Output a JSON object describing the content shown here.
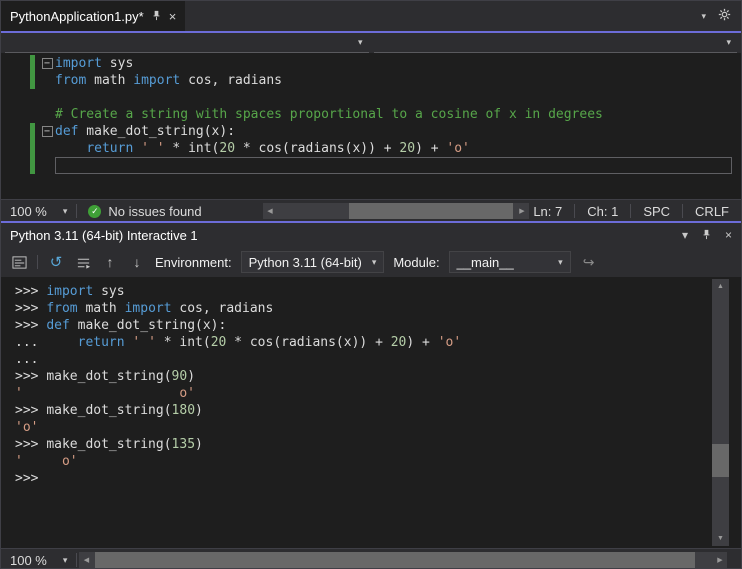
{
  "colors": {
    "accent_purple": "#6c6cd8",
    "keyword_blue": "#569cd6",
    "comment_green": "#57a64a",
    "string_orange": "#d69d85",
    "number_green": "#b5cea8",
    "foreground": "#dcdcdc",
    "issues_ok_green": "#3fa037",
    "change_bar_green": "#419641"
  },
  "icons": {
    "close": "×",
    "chevron_down": "▾",
    "check": "✓",
    "reset": "↺",
    "arrow_up": "↑",
    "arrow_down": "↓",
    "send": "↪",
    "scroll_left": "◀",
    "scroll_right": "▶",
    "scroll_up": "▲",
    "scroll_down": "▼",
    "fold_collapse": "−"
  },
  "tab_bar": {
    "tab_title": "PythonApplication1.py*"
  },
  "editor": {
    "lines": [
      {
        "fold": true,
        "changed": true,
        "tokens": [
          {
            "t": "kw",
            "s": "import"
          },
          {
            "t": "pl",
            "s": " sys"
          }
        ]
      },
      {
        "changed": true,
        "tokens": [
          {
            "t": "kw",
            "s": "from"
          },
          {
            "t": "pl",
            "s": " math "
          },
          {
            "t": "kw",
            "s": "import"
          },
          {
            "t": "pl",
            "s": " cos, radians"
          }
        ]
      },
      {
        "tokens": []
      },
      {
        "tokens": [
          {
            "t": "cm",
            "s": "# Create a string with spaces proportional to a cosine of x in degrees"
          }
        ]
      },
      {
        "fold": true,
        "changed": true,
        "tokens": [
          {
            "t": "kw",
            "s": "def"
          },
          {
            "t": "pl",
            "s": " make_dot_string(x):"
          }
        ]
      },
      {
        "changed": true,
        "tokens": [
          {
            "t": "pl",
            "s": "    "
          },
          {
            "t": "kw",
            "s": "return"
          },
          {
            "t": "pl",
            "s": " "
          },
          {
            "t": "str",
            "s": "' '"
          },
          {
            "t": "pl",
            "s": " * int("
          },
          {
            "t": "num",
            "s": "20"
          },
          {
            "t": "pl",
            "s": " * cos(radians(x)) + "
          },
          {
            "t": "num",
            "s": "20"
          },
          {
            "t": "pl",
            "s": ") + "
          },
          {
            "t": "str",
            "s": "'o'"
          }
        ]
      },
      {
        "changed": true,
        "boxed": true,
        "tokens": []
      }
    ]
  },
  "editor_status": {
    "zoom": "100 %",
    "issues": "No issues found",
    "line": "Ln: 7",
    "column": "Ch: 1",
    "insert_mode": "SPC",
    "line_ending": "CRLF"
  },
  "interactive": {
    "title": "Python 3.11 (64-bit) Interactive 1",
    "toolbar": {
      "environment_label": "Environment:",
      "environment_value": "Python 3.11 (64-bit)",
      "module_label": "Module:",
      "module_value": "__main__"
    },
    "lines": [
      {
        "tokens": [
          {
            "t": "prm",
            "s": ">>> "
          },
          {
            "t": "kw",
            "s": "import"
          },
          {
            "t": "pl",
            "s": " sys"
          }
        ]
      },
      {
        "tokens": [
          {
            "t": "prm",
            "s": ">>> "
          },
          {
            "t": "kw",
            "s": "from"
          },
          {
            "t": "pl",
            "s": " math "
          },
          {
            "t": "kw",
            "s": "import"
          },
          {
            "t": "pl",
            "s": " cos, radians"
          }
        ]
      },
      {
        "tokens": [
          {
            "t": "prm",
            "s": ">>> "
          },
          {
            "t": "kw",
            "s": "def"
          },
          {
            "t": "pl",
            "s": " make_dot_string(x):"
          }
        ]
      },
      {
        "tokens": [
          {
            "t": "prm",
            "s": "... "
          },
          {
            "t": "pl",
            "s": "    "
          },
          {
            "t": "kw",
            "s": "return"
          },
          {
            "t": "pl",
            "s": " "
          },
          {
            "t": "str",
            "s": "' '"
          },
          {
            "t": "pl",
            "s": " * int("
          },
          {
            "t": "num",
            "s": "20"
          },
          {
            "t": "pl",
            "s": " * cos(radians(x)) + "
          },
          {
            "t": "num",
            "s": "20"
          },
          {
            "t": "pl",
            "s": ") + "
          },
          {
            "t": "str",
            "s": "'o'"
          }
        ]
      },
      {
        "tokens": [
          {
            "t": "prm",
            "s": "..."
          }
        ]
      },
      {
        "tokens": [
          {
            "t": "prm",
            "s": ">>> "
          },
          {
            "t": "pl",
            "s": "make_dot_string("
          },
          {
            "t": "num",
            "s": "90"
          },
          {
            "t": "pl",
            "s": ")"
          }
        ]
      },
      {
        "tokens": [
          {
            "t": "str",
            "s": "'                    o'"
          }
        ]
      },
      {
        "tokens": [
          {
            "t": "prm",
            "s": ">>> "
          },
          {
            "t": "pl",
            "s": "make_dot_string("
          },
          {
            "t": "num",
            "s": "180"
          },
          {
            "t": "pl",
            "s": ")"
          }
        ]
      },
      {
        "tokens": [
          {
            "t": "str",
            "s": "'o'"
          }
        ]
      },
      {
        "tokens": [
          {
            "t": "prm",
            "s": ">>> "
          },
          {
            "t": "pl",
            "s": "make_dot_string("
          },
          {
            "t": "num",
            "s": "135"
          },
          {
            "t": "pl",
            "s": ")"
          }
        ]
      },
      {
        "tokens": [
          {
            "t": "str",
            "s": "'     o'"
          }
        ]
      },
      {
        "tokens": [
          {
            "t": "prm",
            "s": ">>> "
          }
        ]
      }
    ],
    "zoom": "100 %"
  }
}
